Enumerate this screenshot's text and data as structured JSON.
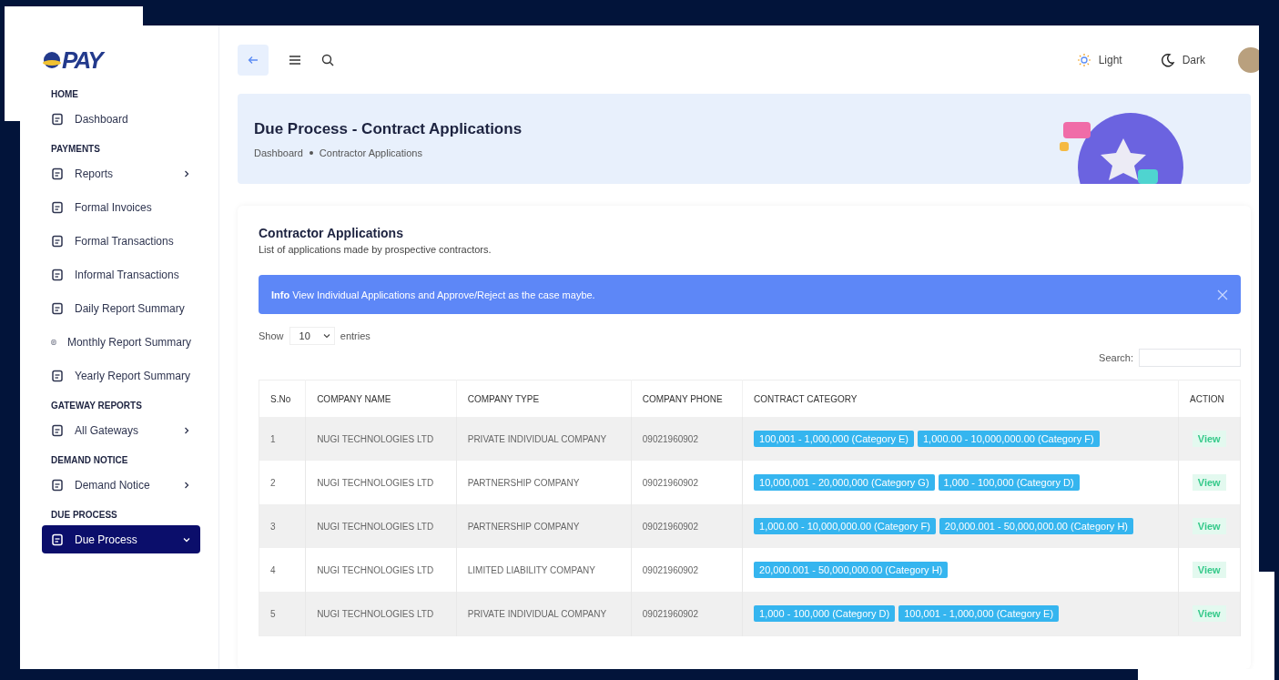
{
  "logo": {
    "text": "PAY"
  },
  "sidebar": {
    "sections": [
      {
        "title": "HOME",
        "items": [
          {
            "label": "Dashboard",
            "kind": "link",
            "selected": false
          }
        ]
      },
      {
        "title": "PAYMENTS",
        "items": [
          {
            "label": "Reports",
            "kind": "submenu",
            "expanded": false,
            "selected": false
          },
          {
            "label": "Formal Invoices",
            "kind": "link",
            "selected": false
          },
          {
            "label": "Formal Transactions",
            "kind": "link",
            "selected": false
          },
          {
            "label": "Informal Transactions",
            "kind": "link",
            "selected": false
          },
          {
            "label": "Daily Report Summary",
            "kind": "link",
            "selected": false
          },
          {
            "label": "Monthly Report Summary",
            "kind": "link",
            "selected": false
          },
          {
            "label": "Yearly Report Summary",
            "kind": "link",
            "selected": false
          }
        ]
      },
      {
        "title": "GATEWAY REPORTS",
        "items": [
          {
            "label": "All Gateways",
            "kind": "submenu",
            "expanded": false,
            "selected": false
          }
        ]
      },
      {
        "title": "DEMAND NOTICE",
        "items": [
          {
            "label": "Demand Notice",
            "kind": "submenu",
            "expanded": false,
            "selected": false
          }
        ]
      },
      {
        "title": "DUE PROCESS",
        "items": [
          {
            "label": "Due Process",
            "kind": "submenu",
            "expanded": true,
            "selected": true
          }
        ]
      }
    ]
  },
  "topbar": {
    "theme_options": [
      {
        "label": "Light",
        "kind": "light"
      },
      {
        "label": "Dark",
        "kind": "dark"
      }
    ]
  },
  "page_header": {
    "title": "Due Process - Contract Applications",
    "breadcrumbs": [
      "Dashboard",
      "Contractor Applications"
    ]
  },
  "card": {
    "title": "Contractor Applications",
    "subtitle": "List of applications made by prospective contractors.",
    "alert": {
      "label": "Info",
      "text": "View Individual Applications and Approve/Reject as the case maybe."
    },
    "length": {
      "before": "Show",
      "value": "10",
      "after": "entries"
    },
    "search_label": "Search:",
    "table": {
      "columns": [
        "S.No",
        "COMPANY NAME",
        "COMPANY TYPE",
        "COMPANY PHONE",
        "CONTRACT CATEGORY",
        "ACTION"
      ],
      "rows": [
        {
          "no": "1",
          "name": "NUGI TECHNOLOGIES LTD",
          "type": "PRIVATE INDIVIDUAL COMPANY",
          "phone": "09021960902",
          "categories": [
            "100,001 - 1,000,000 (Category E)",
            "1,000.00 - 10,000,000.00 (Category F)"
          ],
          "action": "View"
        },
        {
          "no": "2",
          "name": "NUGI TECHNOLOGIES LTD",
          "type": "PARTNERSHIP COMPANY",
          "phone": "09021960902",
          "categories": [
            "10,000,001 - 20,000,000 (Category G)",
            "1,000 - 100,000 (Category D)"
          ],
          "action": "View"
        },
        {
          "no": "3",
          "name": "NUGI TECHNOLOGIES LTD",
          "type": "PARTNERSHIP COMPANY",
          "phone": "09021960902",
          "categories": [
            "1,000.00 - 10,000,000.00 (Category F)",
            "20,000.001 - 50,000,000.00 (Category H)"
          ],
          "action": "View"
        },
        {
          "no": "4",
          "name": "NUGI TECHNOLOGIES LTD",
          "type": "LIMITED LIABILITY COMPANY",
          "phone": "09021960902",
          "categories": [
            "20,000.001 - 50,000,000.00 (Category H)"
          ],
          "action": "View"
        },
        {
          "no": "5",
          "name": "NUGI TECHNOLOGIES LTD",
          "type": "PRIVATE INDIVIDUAL COMPANY",
          "phone": "09021960902",
          "categories": [
            "1,000 - 100,000 (Category D)",
            "100,001 - 1,000,000 (Category E)"
          ],
          "action": "View"
        }
      ]
    }
  }
}
